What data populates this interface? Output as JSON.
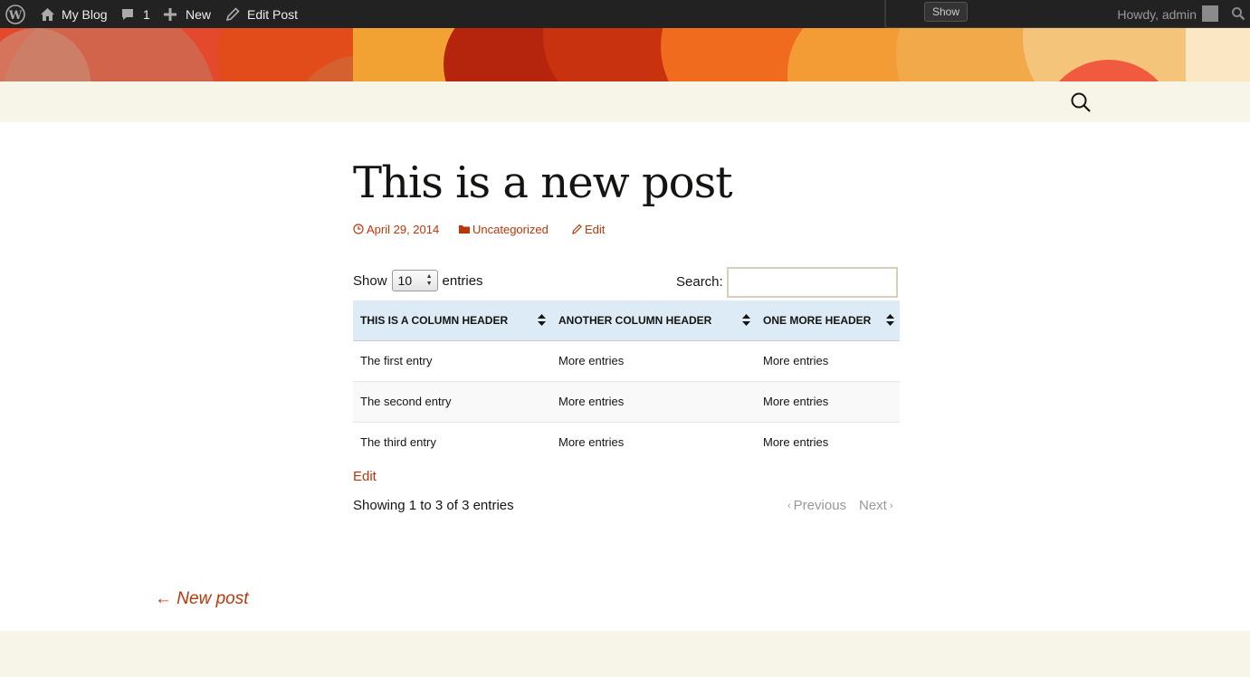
{
  "adminbar": {
    "wp_logo_icon": "wordpress-icon",
    "site_name": "My Blog",
    "comments_count": "1",
    "new_label": "New",
    "edit_post_label": "Edit Post",
    "show_button_label": "Show",
    "howdy_text": "Howdy, admin"
  },
  "post": {
    "title": "This is a new post",
    "date": "April 29, 2014",
    "category": "Uncategorized",
    "edit_label": "Edit"
  },
  "datatable": {
    "show_label": "Show",
    "page_length": "10",
    "entries_label": "entries",
    "search_label": "Search:",
    "search_value": "",
    "columns": [
      "THIS IS A COLUMN HEADER",
      "ANOTHER COLUMN HEADER",
      "ONE MORE HEADER"
    ],
    "rows": [
      [
        "The first entry",
        "More entries",
        "More entries"
      ],
      [
        "The second entry",
        "More entries",
        "More entries"
      ],
      [
        "The third entry",
        "More entries",
        "More entries"
      ]
    ],
    "info": "Showing 1 to 3 of 3 entries",
    "previous_label": "Previous",
    "next_label": "Next"
  },
  "content_edit_label": "Edit",
  "post_nav": {
    "previous_post": "← New post"
  },
  "colors": {
    "accent": "#bc360a",
    "adminbar_bg": "#222222",
    "nav_bg": "#f7f4e8",
    "table_header_bg": "#dcebf5"
  }
}
